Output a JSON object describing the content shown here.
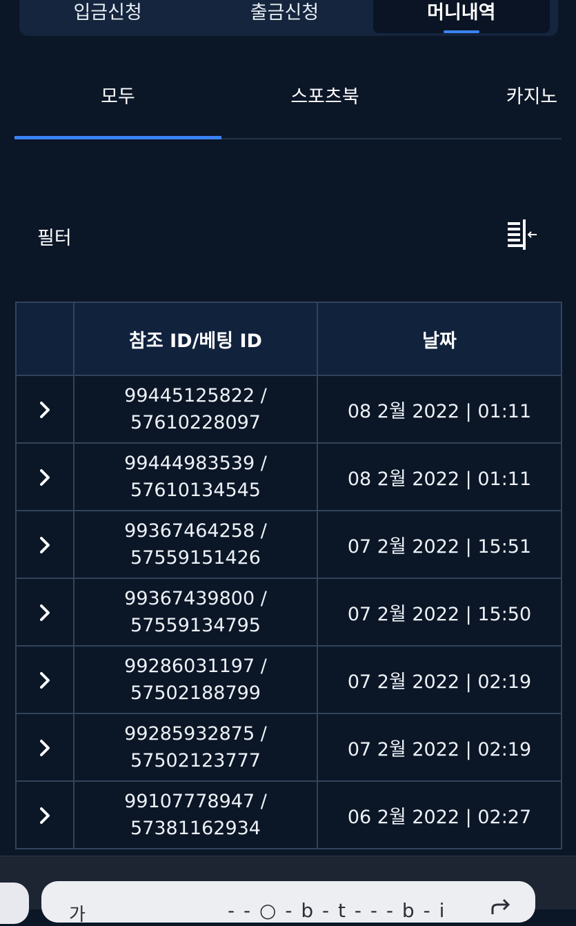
{
  "top_tabs": [
    {
      "label": "입금신청"
    },
    {
      "label": "출금신청"
    },
    {
      "label": "머니내역"
    }
  ],
  "sub_tabs": [
    {
      "label": "모두"
    },
    {
      "label": "스포츠북"
    },
    {
      "label": "카지노"
    }
  ],
  "filter": {
    "label": "필터",
    "icon": "collapse-columns-icon"
  },
  "table": {
    "headers": {
      "ids": "참조 ID/베팅 ID",
      "date": "날짜"
    },
    "rows": [
      {
        "ref": "99445125822 /",
        "bet": "57610228097",
        "date": "08 2월 2022 | 01:11"
      },
      {
        "ref": "99444983539 /",
        "bet": "57610134545",
        "date": "08 2월 2022 | 01:11"
      },
      {
        "ref": "99367464258 /",
        "bet": "57559151426",
        "date": "07 2월 2022 | 15:51"
      },
      {
        "ref": "99367439800 /",
        "bet": "57559134795",
        "date": "07 2월 2022 | 15:50"
      },
      {
        "ref": "99286031197 /",
        "bet": "57502188799",
        "date": "07 2월 2022 | 02:19"
      },
      {
        "ref": "99285932875 /",
        "bet": "57502123777",
        "date": "07 2월 2022 | 02:19"
      },
      {
        "ref": "99107778947 /",
        "bet": "57381162934",
        "date": "06 2월 2022 | 02:27"
      }
    ]
  },
  "browser": {
    "left_text": "가",
    "url_text": "- - ○ - b - t - - - b - i",
    "icon": "share-icon"
  },
  "colors": {
    "accent": "#3b82f6",
    "background": "#0b1627",
    "header_bg": "#11223d",
    "border": "#33435a"
  }
}
